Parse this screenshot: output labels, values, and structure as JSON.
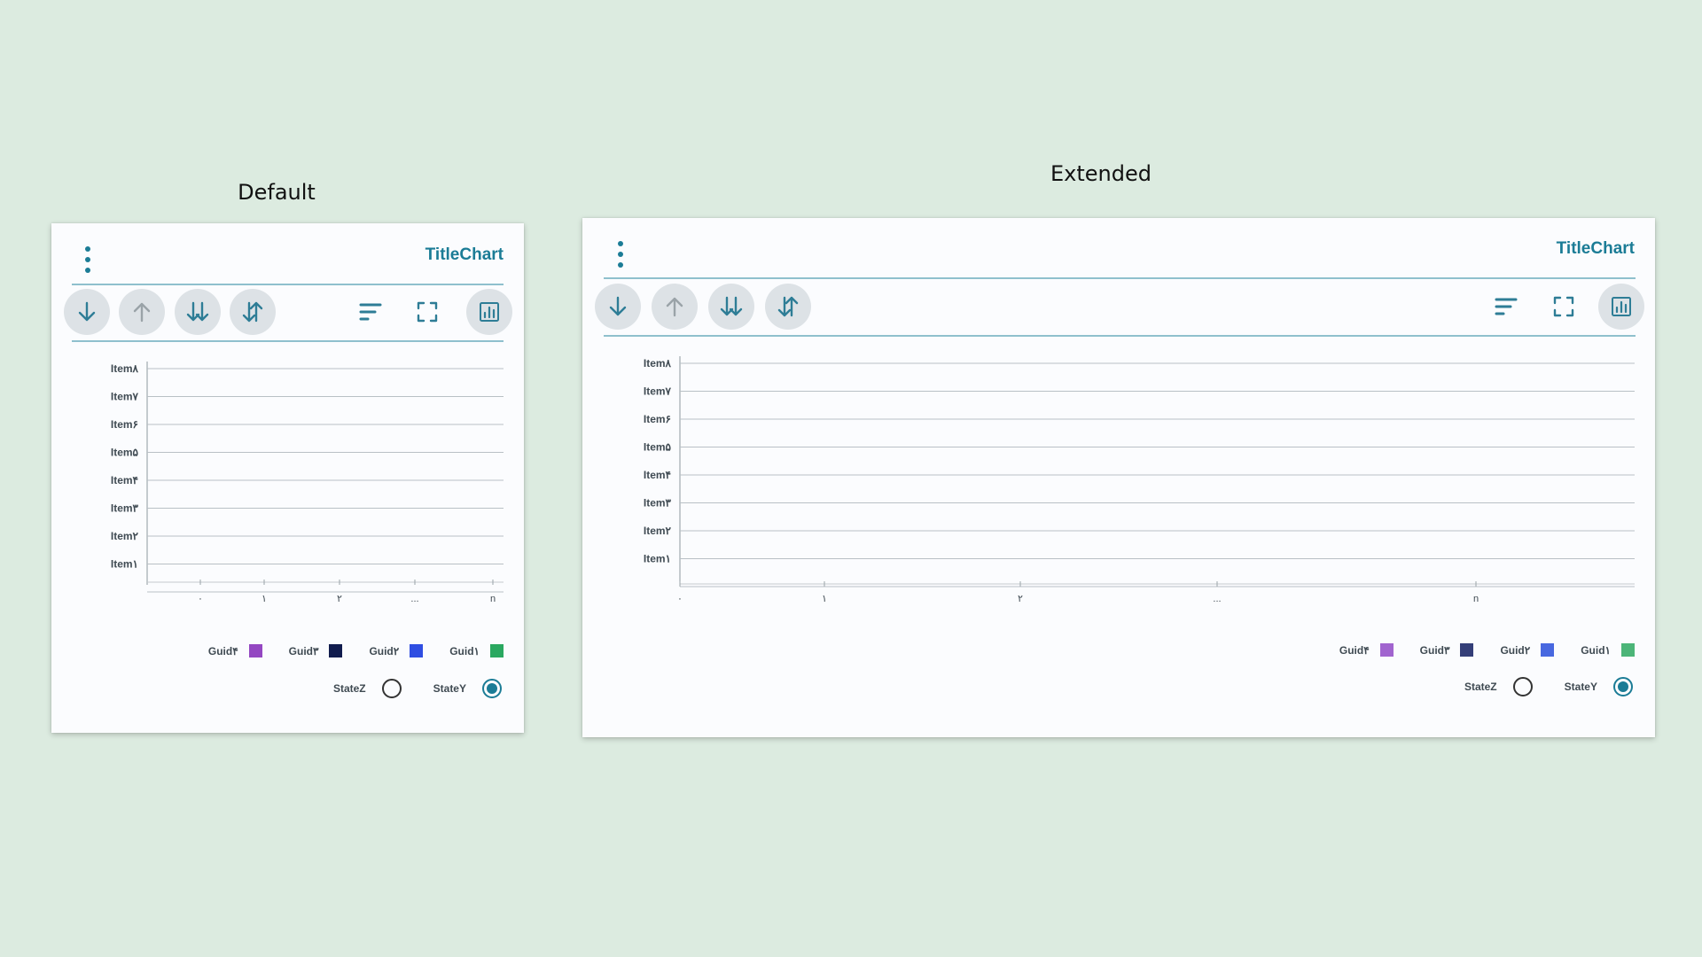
{
  "variants": [
    {
      "label": "Default",
      "title": "TitleChart",
      "toolbar": {
        "left_buttons": [
          "arrow-down-icon",
          "arrow-up-icon",
          "double-arrow-down-icon",
          "swap-vertical-icon"
        ],
        "right_buttons": [
          "sort-lines-icon",
          "fullscreen-icon",
          "chart-icon"
        ]
      },
      "y_items": [
        "Item۸",
        "Item۷",
        "Item۶",
        "Item۵",
        "Item۴",
        "Item۳",
        "Item۲",
        "Item۱"
      ],
      "x_ticks": [
        "۰",
        "۱",
        "۲",
        "...",
        "n"
      ],
      "legend": [
        {
          "label": "Guid۴",
          "color": "#9447c2"
        },
        {
          "label": "Guid۳",
          "color": "#111c4e"
        },
        {
          "label": "Guid۲",
          "color": "#2f4ee2"
        },
        {
          "label": "Guid۱",
          "color": "#2aa860"
        }
      ],
      "states": [
        {
          "label": "StateZ",
          "checked": false
        },
        {
          "label": "StateY",
          "checked": true
        }
      ]
    },
    {
      "label": "Extended",
      "title": "TitleChart",
      "toolbar": {
        "left_buttons": [
          "arrow-down-icon",
          "arrow-up-icon",
          "double-arrow-down-icon",
          "swap-vertical-icon"
        ],
        "right_buttons": [
          "sort-lines-icon",
          "fullscreen-icon",
          "chart-icon"
        ]
      },
      "y_items": [
        "Item۸",
        "Item۷",
        "Item۶",
        "Item۵",
        "Item۴",
        "Item۳",
        "Item۲",
        "Item۱"
      ],
      "x_ticks": [
        "۰",
        "۱",
        "۲",
        "...",
        "n"
      ],
      "legend": [
        {
          "label": "Guid۴",
          "color": "#a164cf"
        },
        {
          "label": "Guid۳",
          "color": "#343e78"
        },
        {
          "label": "Guid۲",
          "color": "#4868e0"
        },
        {
          "label": "Guid۱",
          "color": "#4cb578"
        }
      ],
      "states": [
        {
          "label": "StateZ",
          "checked": false
        },
        {
          "label": "StateY",
          "checked": true
        }
      ]
    }
  ]
}
